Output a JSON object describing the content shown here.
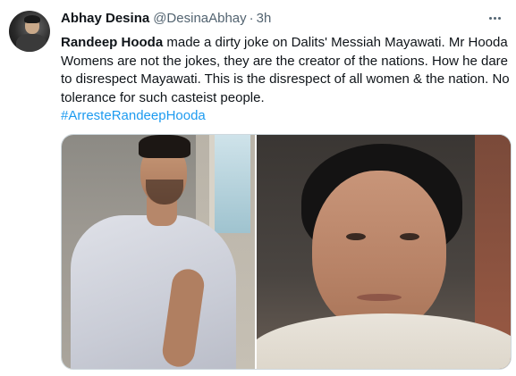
{
  "tweet": {
    "display_name": "Abhay Desina",
    "handle": "@DesinaAbhay",
    "separator": "·",
    "time": "3h",
    "text_mention": "Randeep Hooda",
    "text_body": " made a dirty joke on Dalits' Messiah Mayawati. Mr Hooda Womens are not the jokes, they are the creator of the nations. How he dare to disrespect Mayawati. This is the disrespect of all women & the nation. No tolerance for such casteist people.",
    "hashtag": "#ArresteRandeepHooda"
  },
  "icons": {
    "more": "more-horizontal-icon"
  },
  "colors": {
    "link": "#1d9bf0",
    "text": "#0f1419",
    "secondary": "#536471",
    "border": "#cfd9de"
  }
}
